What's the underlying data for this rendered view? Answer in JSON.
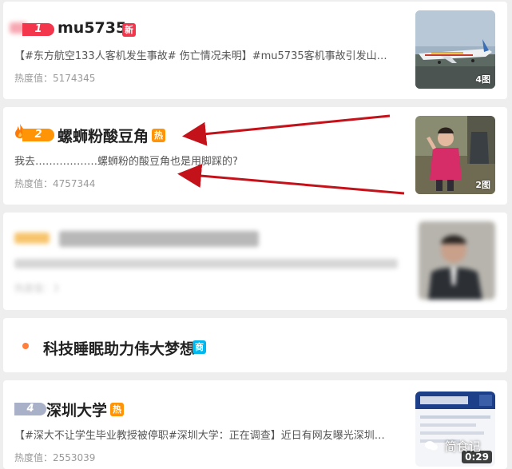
{
  "items": [
    {
      "rank": "1",
      "title": "mu5735",
      "badge": "新",
      "summary": "【#东方航空133人客机发生事故# 伤亡情况未明】#mu5735客机事故引发山…",
      "heat_label": "热度值：5174345",
      "thumb_count": "4图"
    },
    {
      "rank": "2",
      "title": "螺蛳粉酸豆角",
      "badge": "热",
      "summary": "我去………………螺蛳粉的酸豆角也是用脚踩的?",
      "heat_label": "热度值：4757344",
      "thumb_count": "2图"
    },
    {
      "heat_label": "热度值：3"
    },
    {
      "title": "科技睡眠助力伟大梦想",
      "badge": "商"
    },
    {
      "rank": "4",
      "title": "深圳大学",
      "badge": "热",
      "summary": "【#深大不让学生毕业教授被停职#深圳大学：正在调查】近日有网友曝光深圳…",
      "heat_label": "热度值：2553039",
      "video_duration": "0:29"
    }
  ],
  "watermark": "简食记",
  "colors": {
    "rank1": "#f4364c",
    "rank2": "#ff9406",
    "rank4": "#a8b1c8",
    "badge_new": "#f4364c",
    "badge_hot": "#ff9406",
    "badge_ad": "#00b7ee",
    "arrow": "#c4121b"
  }
}
